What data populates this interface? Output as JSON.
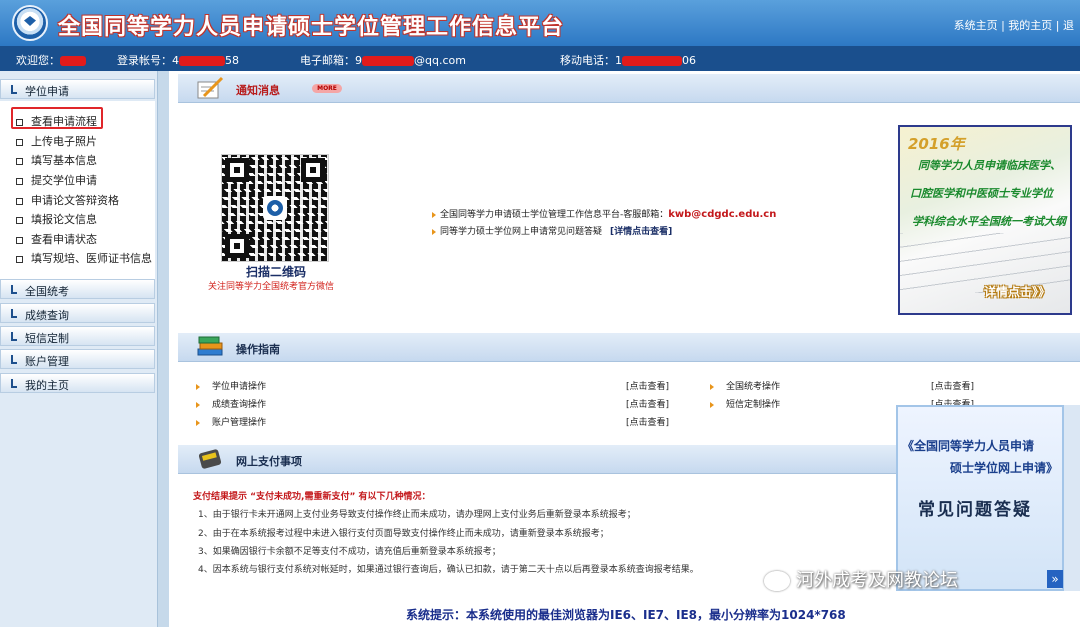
{
  "header": {
    "title": "全国同等学力人员申请硕士学位管理工作信息平台",
    "links": [
      "系统主页",
      "我的主页",
      "|",
      "退"
    ]
  },
  "userbar": {
    "welcome": "欢迎您：",
    "account_label": "登录帐号：",
    "account_value_start": "4",
    "account_value_end": "58",
    "email_label": "电子邮箱：",
    "email_value_start": "9",
    "email_value_end": "@qq.com",
    "phone_label": "移动电话：",
    "phone_value_start": "1",
    "phone_value_end": "06"
  },
  "sidebar": {
    "sections": [
      "学位申请",
      "全国统考",
      "成绩查询",
      "短信定制",
      "账户管理",
      "我的主页"
    ],
    "items": [
      "查看申请流程",
      "上传电子照片",
      "填写基本信息",
      "提交学位申请",
      "申请论文答辩资格",
      "填报论文信息",
      "查看申请状态",
      "填写规培、医师证书信息"
    ]
  },
  "notice": {
    "title": "通知消息",
    "more": "MORE",
    "qr_caption": "扫描二维码",
    "qr_sub": "关注同等学力全国统考官方微信",
    "line1": "全国同等学力申请硕士学位管理工作信息平台-客服邮箱：",
    "line1_email": "kwb@cdgdc.edu.cn",
    "line2": "同等学力硕士学位网上申请常见问题答疑",
    "line2_link": "[详情点击查看]"
  },
  "promo": {
    "year": "2016年",
    "line1": "同等学力人员申请临床医学、",
    "line2": "口腔医学和中医硕士专业学位",
    "line3": "学科综合水平全国统一考试大纲",
    "button": "详情点击》》"
  },
  "guide": {
    "title": "操作指南",
    "left": [
      "学位申请操作",
      "成绩查询操作",
      "账户管理操作"
    ],
    "right": [
      "全国统考操作",
      "短信定制操作"
    ],
    "link": "[点击查看]"
  },
  "faq": {
    "line1": "《全国同等学力人员申请",
    "line2": "硕士学位网上申请》",
    "line3": "常见问题答疑",
    "button": "»"
  },
  "payment": {
    "title": "网上支付事项",
    "result_title": "支付结果提示 “支付未成功,需重新支付” 有以下几种情况：",
    "items": [
      "1、由于银行卡未开通网上支付业务导致支付操作终止而未成功，请办理网上支付业务后重新登录本系统报考；",
      "2、由于在本系统报考过程中未进入银行支付页面导致支付操作终止而未成功，请重新登录本系统报考；",
      "3、如果确因银行卡余额不足等支付不成功，请充值后重新登录本系统报考；",
      "4、因本系统与银行支付系统对帐延时，如果通过银行查询后，确认已扣款，请于第二天十点以后再登录本系统查询报考结果。"
    ]
  },
  "system_tip": "系统提示：本系统使用的最佳浏览器为IE6、IE7、IE8，最小分辨率为1024*768",
  "watermark": "河外成考及网教论坛",
  "colors": {
    "header_blue": "#2d78c4",
    "userbar": "#1a4f8d",
    "alert_red": "#c3181b",
    "highlight": "#e0262a"
  }
}
